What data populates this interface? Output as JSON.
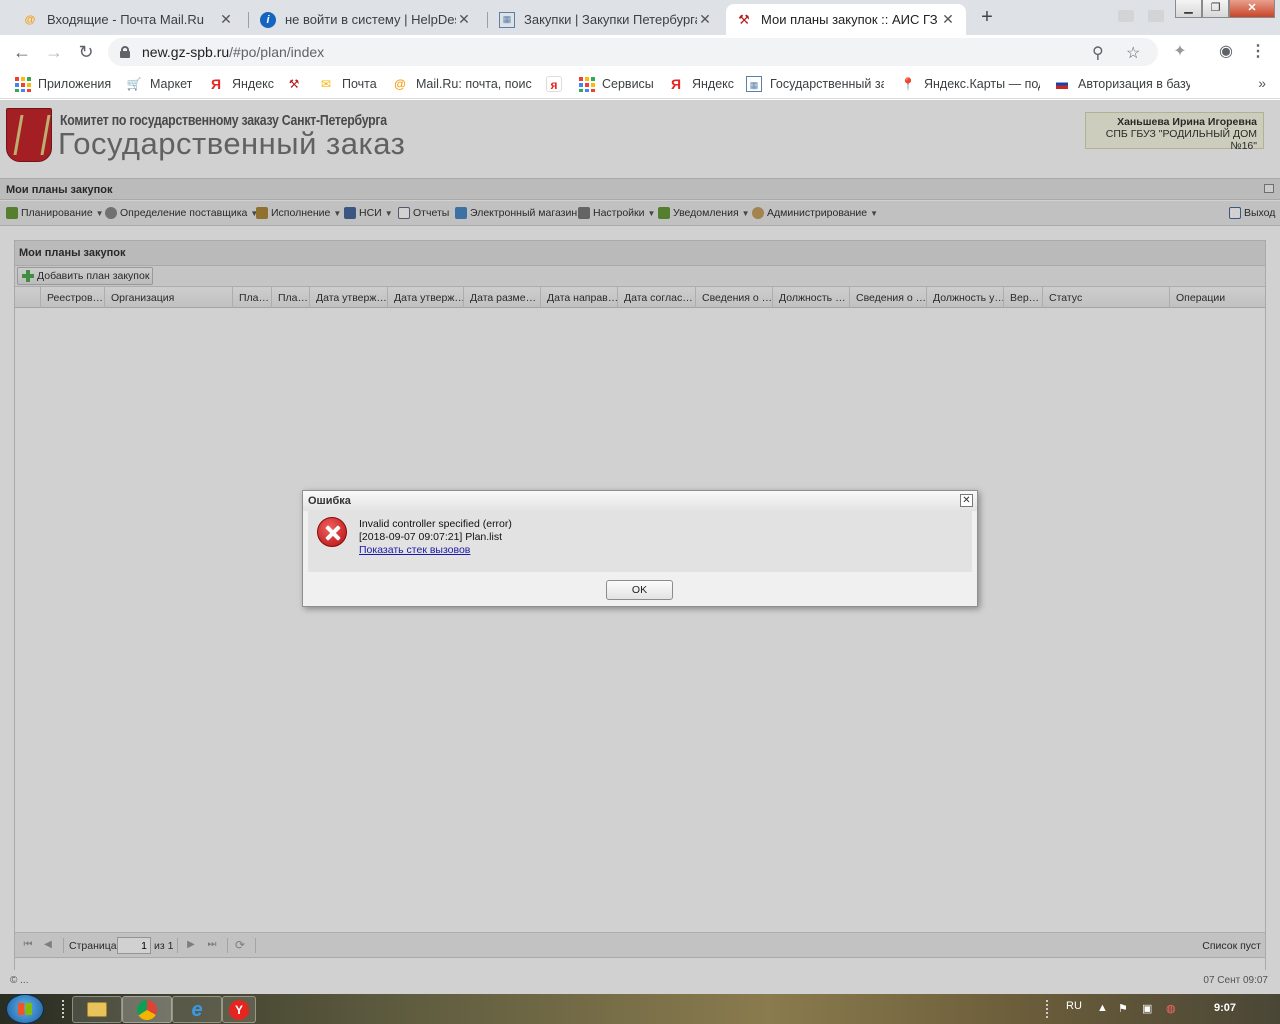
{
  "browser": {
    "tabs": [
      {
        "title": "Входящие - Почта Mail.Ru",
        "icon": "mailru-icon"
      },
      {
        "title": "не войти в систему | HelpDesk -",
        "icon": "info-icon"
      },
      {
        "title": "Закупки | Закупки Петербурга",
        "icon": "gz-icon"
      },
      {
        "title": "Мои планы закупок :: АИС ГЗ",
        "icon": "gavel-icon",
        "active": true
      }
    ],
    "url_host": "new.gz-spb.ru",
    "url_path": "/#po/plan/index",
    "bookmarks": [
      {
        "label": "Приложения",
        "icon": "apps-grid-icon"
      },
      {
        "label": "Маркет",
        "icon": "cart-icon"
      },
      {
        "label": "Яндекс",
        "icon": "yandex-icon"
      },
      {
        "label": "",
        "icon": "gavel-icon"
      },
      {
        "label": "Почта",
        "icon": "mail-envelope-icon"
      },
      {
        "label": "Mail.Ru: почта, поис",
        "icon": "mailru-icon"
      },
      {
        "label": "",
        "icon": "yandex-square-icon"
      },
      {
        "label": "Сервисы",
        "icon": "apps-grid-icon"
      },
      {
        "label": "Яндекс",
        "icon": "yandex-icon"
      },
      {
        "label": "Государственный за",
        "icon": "gz-icon"
      },
      {
        "label": "Яндекс.Карты — под",
        "icon": "map-pin-icon"
      },
      {
        "label": "Авторизация в базу",
        "icon": "flag-icon"
      }
    ],
    "more_label": "»"
  },
  "header": {
    "subtitle": "Комитет по государственному заказу Санкт-Петербурга",
    "title": "Государственный заказ",
    "user_name": "Ханьшева Ирина Игоревна",
    "user_org": "СПБ ГБУЗ \"РОДИЛЬНЫЙ ДОМ №16\""
  },
  "section_title": "Мои планы закупок",
  "menu": {
    "items": [
      {
        "label": "Планирование",
        "caret": true,
        "color": "#6a9a3a"
      },
      {
        "label": "Определение поставщика",
        "caret": true,
        "color": "#8a8a8a"
      },
      {
        "label": "Исполнение",
        "caret": true,
        "color": "#b08a3a"
      },
      {
        "label": "НСИ",
        "caret": true,
        "color": "#4a6aa0"
      },
      {
        "label": "Отчеты",
        "caret": false,
        "color": "#6a6a8a"
      },
      {
        "label": "Электронный магазин",
        "caret": false,
        "color": "#4a8ac8"
      },
      {
        "label": "Настройки",
        "caret": true,
        "color": "#7a7a7a"
      },
      {
        "label": "Уведомления",
        "caret": true,
        "color": "#6a9a3a"
      },
      {
        "label": "Администрирование",
        "caret": true,
        "color": "#c8a060"
      }
    ],
    "logout": "Выход"
  },
  "panel": {
    "title": "Мои планы закупок",
    "add_button": "Добавить план закупок",
    "columns": [
      "Реестров…",
      "Организация",
      "Пла…",
      "Пла…",
      "Дата утверж…",
      "Дата утверж…",
      "Дата разме…",
      "Дата направ…",
      "Дата соглас…",
      "Сведения о …",
      "Должность …",
      "Сведения о …",
      "Должность у…",
      "Вер…",
      "Статус",
      "Операции"
    ]
  },
  "pager": {
    "page_label": "Страница",
    "page_value": "1",
    "of_label": "из 1",
    "empty_label": "Список пуст"
  },
  "footer": {
    "left": "© ...",
    "right": "07 Сент 09:07"
  },
  "dialog": {
    "title": "Ошибка",
    "line1": "Invalid controller specified (error)",
    "line2": "[2018-09-07 09:07:21] Plan.list",
    "link": "Показать стек вызовов",
    "ok": "OK"
  },
  "taskbar": {
    "lang": "RU",
    "time": "9:07"
  }
}
